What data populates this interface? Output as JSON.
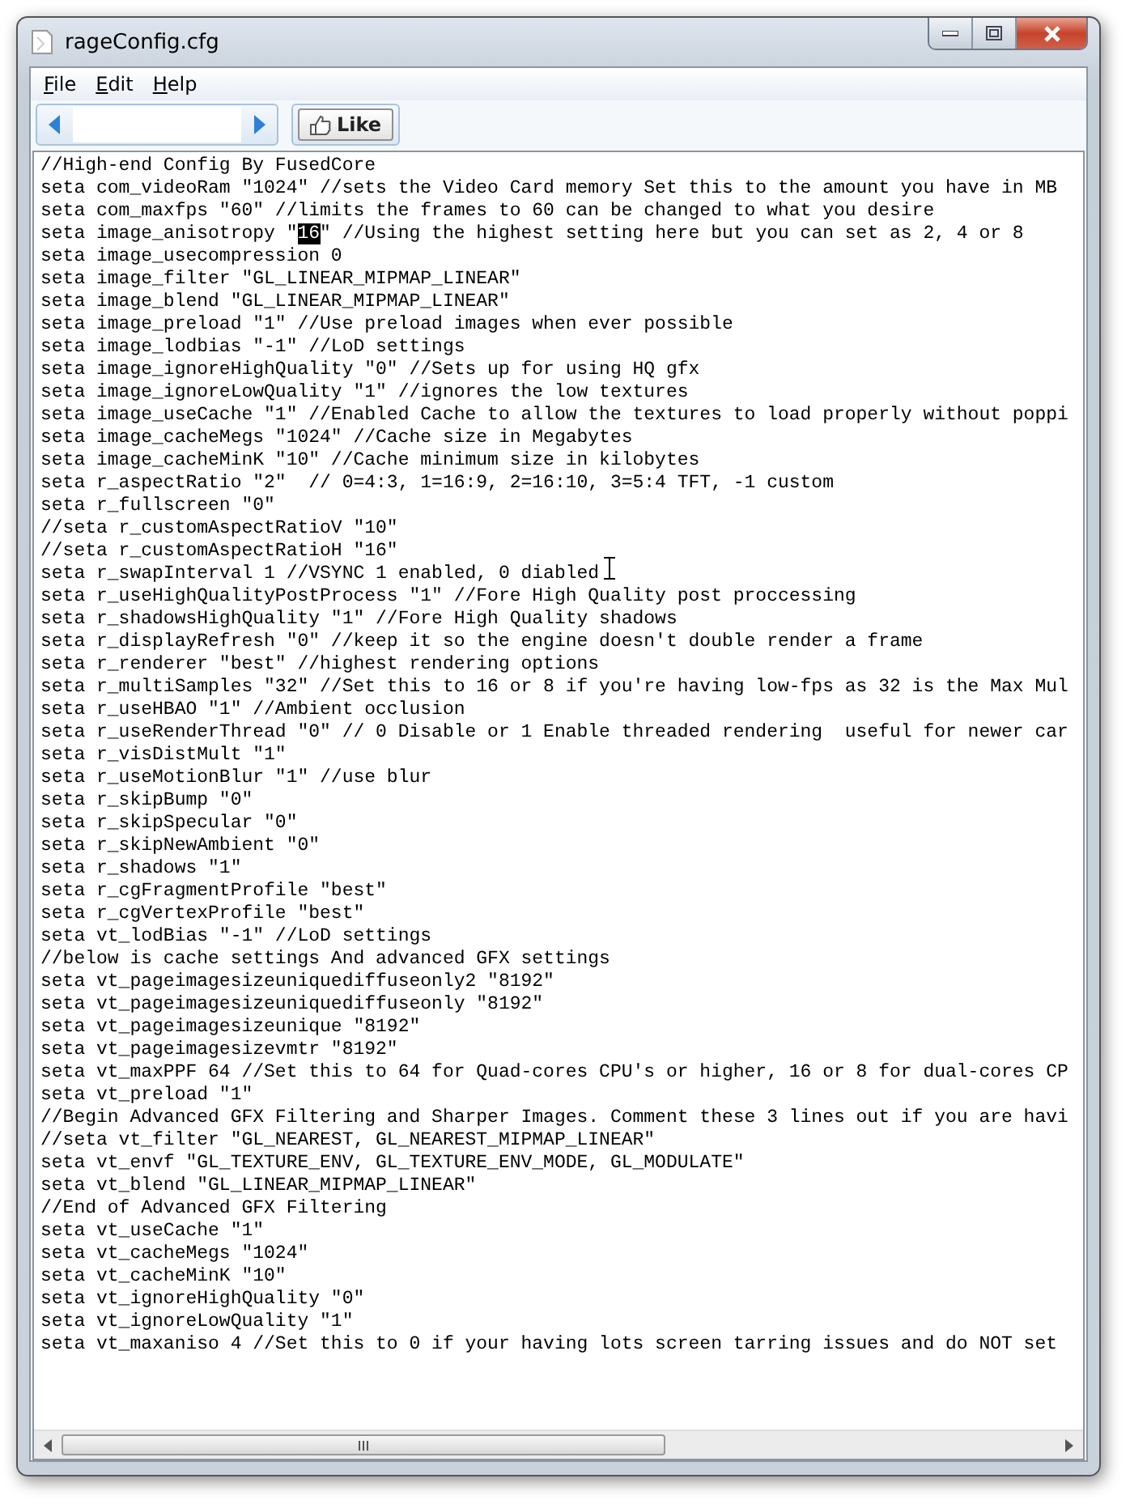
{
  "window": {
    "title": "rageConfig.cfg"
  },
  "menu": [
    "File",
    "Edit",
    "Help"
  ],
  "toolbar": {
    "like_button": "Like"
  },
  "editor": {
    "lines": [
      {
        "text": "//High-end Config By FusedCore"
      },
      {
        "text": "seta com_videoRam \"1024\" //sets the Video Card memory Set this to the amount you have in MB"
      },
      {
        "text": "seta com_maxfps \"60\" //limits the frames to 60 can be changed to what you desire"
      },
      {
        "kind": "selection",
        "parts": [
          {
            "text": "seta image_anisotropy \"",
            "selected": false
          },
          {
            "text": "16",
            "selected": true
          },
          {
            "text": "\" //Using the highest setting here but you can set as 2, 4 or 8",
            "selected": false
          }
        ]
      },
      {
        "text": "seta image_usecompression 0"
      },
      {
        "text": "seta image_filter \"GL_LINEAR_MIPMAP_LINEAR\""
      },
      {
        "text": "seta image_blend \"GL_LINEAR_MIPMAP_LINEAR\""
      },
      {
        "text": "seta image_preload \"1\" //Use preload images when ever possible"
      },
      {
        "text": "seta image_lodbias \"-1\" //LoD settings"
      },
      {
        "text": "seta image_ignoreHighQuality \"0\" //Sets up for using HQ gfx"
      },
      {
        "text": "seta image_ignoreLowQuality \"1\" //ignores the low textures"
      },
      {
        "text": "seta image_useCache \"1\" //Enabled Cache to allow the textures to load properly without poppi"
      },
      {
        "text": "seta image_cacheMegs \"1024\" //Cache size in Megabytes"
      },
      {
        "text": "seta image_cacheMinK \"10\" //Cache minimum size in kilobytes"
      },
      {
        "text": "seta r_aspectRatio \"2\"  // 0=4:3, 1=16:9, 2=16:10, 3=5:4 TFT, -1 custom"
      },
      {
        "text": "seta r_fullscreen \"0\""
      },
      {
        "text": "//seta r_customAspectRatioV \"10\""
      },
      {
        "text": "//seta r_customAspectRatioH \"16\""
      },
      {
        "text": "seta r_swapInterval 1 //VSYNC 1 enabled, 0 diabled"
      },
      {
        "text": "seta r_useHighQualityPostProcess \"1\" //Fore High Quality post proccessing"
      },
      {
        "text": "seta r_shadowsHighQuality \"1\" //Fore High Quality shadows"
      },
      {
        "text": "seta r_displayRefresh \"0\" //keep it so the engine doesn't double render a frame"
      },
      {
        "text": "seta r_renderer \"best\" //highest rendering options"
      },
      {
        "text": "seta r_multiSamples \"32\" //Set this to 16 or 8 if you're having low-fps as 32 is the Max Mul"
      },
      {
        "text": "seta r_useHBAO \"1\" //Ambient occlusion"
      },
      {
        "text": "seta r_useRenderThread \"0\" // 0 Disable or 1 Enable threaded rendering  useful for newer car"
      },
      {
        "text": "seta r_visDistMult \"1\""
      },
      {
        "text": "seta r_useMotionBlur \"1\" //use blur"
      },
      {
        "text": "seta r_skipBump \"0\""
      },
      {
        "text": "seta r_skipSpecular \"0\""
      },
      {
        "text": "seta r_skipNewAmbient \"0\""
      },
      {
        "text": "seta r_shadows \"1\""
      },
      {
        "text": "seta r_cgFragmentProfile \"best\""
      },
      {
        "text": "seta r_cgVertexProfile \"best\""
      },
      {
        "text": "seta vt_lodBias \"-1\" //LoD settings"
      },
      {
        "text": "//below is cache settings And advanced GFX settings"
      },
      {
        "text": "seta vt_pageimagesizeuniquediffuseonly2 \"8192\""
      },
      {
        "text": "seta vt_pageimagesizeuniquediffuseonly \"8192\""
      },
      {
        "text": "seta vt_pageimagesizeunique \"8192\""
      },
      {
        "text": "seta vt_pageimagesizevmtr \"8192\""
      },
      {
        "text": "seta vt_maxPPF 64 //Set this to 64 for Quad-cores CPU's or higher, 16 or 8 for dual-cores CP"
      },
      {
        "text": "seta vt_preload \"1\""
      },
      {
        "text": "//Begin Advanced GFX Filtering and Sharper Images. Comment these 3 lines out if you are havi"
      },
      {
        "text": "//seta vt_filter \"GL_NEAREST, GL_NEAREST_MIPMAP_LINEAR\""
      },
      {
        "text": "seta vt_envf \"GL_TEXTURE_ENV, GL_TEXTURE_ENV_MODE, GL_MODULATE\""
      },
      {
        "text": "seta vt_blend \"GL_LINEAR_MIPMAP_LINEAR\""
      },
      {
        "text": "//End of Advanced GFX Filtering"
      },
      {
        "text": "seta vt_useCache \"1\""
      },
      {
        "text": "seta vt_cacheMegs \"1024\""
      },
      {
        "text": "seta vt_cacheMinK \"10\""
      },
      {
        "text": "seta vt_ignoreHighQuality \"0\""
      },
      {
        "text": "seta vt_ignoreLowQuality \"1\""
      },
      {
        "text": "seta vt_maxaniso 4 //Set this to 0 if your having lots screen tarring issues and do NOT set"
      }
    ]
  }
}
